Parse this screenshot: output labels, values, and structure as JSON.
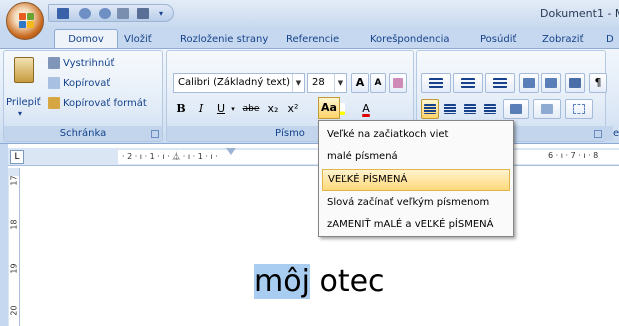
{
  "window": {
    "title": "Dokument1 - M"
  },
  "tabs": [
    "Domov",
    "Vložiť",
    "Rozloženie strany",
    "Referencie",
    "Korešpondencia",
    "Posúdiť",
    "Zobraziť",
    "D"
  ],
  "clipboard": {
    "paste_label": "Prilepiť",
    "cut_label": "Vystrihnúť",
    "copy_label": "Kopírovať",
    "format_painter_label": "Kopírovať formát",
    "group_label": "Schránka"
  },
  "font": {
    "name": "Calibri (Základný text)",
    "size": "28",
    "group_label": "Písmo",
    "bold": "B",
    "italic": "I",
    "underline": "U",
    "strike": "abe",
    "subscript": "x₂",
    "superscript": "x²",
    "change_case": "Aa",
    "grow": "A",
    "shrink": "A"
  },
  "paragraph": {
    "group_label": "ek"
  },
  "styles": {
    "label_fragment": "¶"
  },
  "ruler": {
    "marks": "· 2 · ı · 1 · ı · ⏅ · ı · 1 · ı ·",
    "marks_right": "6 · ı · 7 · ı · 8",
    "corner": "L",
    "vmarks": [
      "17",
      "18",
      "19",
      "20"
    ]
  },
  "change_case_menu": {
    "items": [
      {
        "label": "Veľké na začiatkoch viet",
        "highlighted": false
      },
      {
        "label": "malé písmená",
        "highlighted": false
      },
      {
        "label": "VEĽKÉ PÍSMENÁ",
        "highlighted": true
      },
      {
        "label": "Slová začínať veľkým písmenom",
        "highlighted": false
      },
      {
        "label": "zAMENIŤ mALÉ a vEĽKÉ pÍSMENÁ",
        "highlighted": false
      }
    ]
  },
  "document": {
    "selected_text": "môj",
    "rest_text": " otec"
  },
  "colors": {
    "ribbon": "#dde8f6",
    "accent": "#15428b",
    "highlight": "#ffd87a",
    "selection": "#a8cdf0"
  }
}
